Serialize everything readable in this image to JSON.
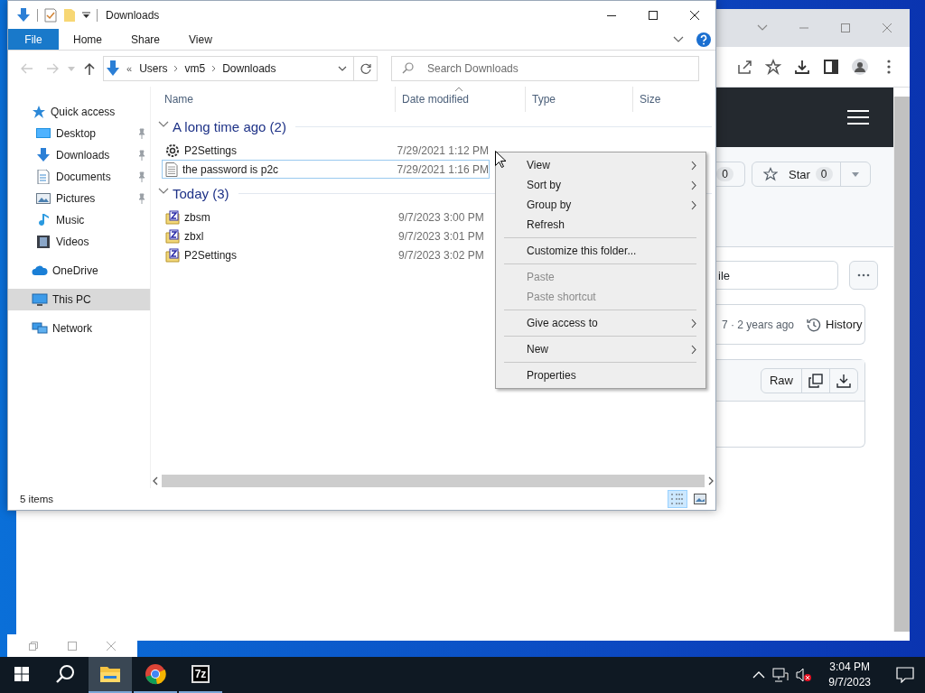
{
  "browser": {
    "fork_count": "0",
    "star_button": {
      "label": "Star",
      "count": "0"
    },
    "file_field": {
      "value": "ile"
    },
    "commit_text": "7 · 2 years ago",
    "history_button": "History",
    "raw_button": "Raw"
  },
  "explorer": {
    "title": "Downloads",
    "ribbon_tabs": [
      {
        "label": "File",
        "kind": "file"
      },
      {
        "label": "Home",
        "kind": "tab"
      },
      {
        "label": "Share",
        "kind": "tab"
      },
      {
        "label": "View",
        "kind": "tab"
      }
    ],
    "breadcrumb_overflow": "«",
    "breadcrumb": [
      "Users",
      "vm5",
      "Downloads"
    ],
    "search": {
      "placeholder": "Search Downloads"
    },
    "nav": [
      {
        "label": "Quick access",
        "selected": false,
        "children": [
          {
            "label": "Desktop",
            "pinned": true,
            "selected": false
          },
          {
            "label": "Downloads",
            "pinned": true,
            "selected": false
          },
          {
            "label": "Documents",
            "pinned": true,
            "selected": false
          },
          {
            "label": "Pictures",
            "pinned": true,
            "selected": false
          },
          {
            "label": "Music",
            "pinned": false,
            "selected": false
          },
          {
            "label": "Videos",
            "pinned": false,
            "selected": false
          }
        ]
      },
      {
        "label": "OneDrive",
        "selected": false
      },
      {
        "label": "This PC",
        "selected": true
      },
      {
        "label": "Network",
        "selected": false
      }
    ],
    "columns": [
      "Name",
      "Date modified",
      "Type",
      "Size"
    ],
    "groups": [
      {
        "title": "A long time ago (2)",
        "expanded": true,
        "files": [
          {
            "name": "P2Settings",
            "kind": "application",
            "date": "7/29/2021 1:12 PM",
            "focused": false
          },
          {
            "name": "the password is p2c",
            "kind": "document",
            "date": "7/29/2021 1:16 PM",
            "focused": true
          }
        ]
      },
      {
        "title": "Today (3)",
        "expanded": true,
        "files": [
          {
            "name": "zbsm",
            "kind": "archive",
            "date": "9/7/2023 3:00 PM",
            "focused": false
          },
          {
            "name": "zbxl",
            "kind": "archive",
            "date": "9/7/2023 3:01 PM",
            "focused": false
          },
          {
            "name": "P2Settings",
            "kind": "archive",
            "date": "9/7/2023 3:02 PM",
            "focused": false
          }
        ]
      }
    ],
    "status": "5 items",
    "view_buttons": [
      {
        "kind": "details",
        "selected": true
      },
      {
        "kind": "large",
        "selected": false
      }
    ]
  },
  "context_menu": [
    {
      "kind": "item",
      "label": "View",
      "submenu": true,
      "disabled": false
    },
    {
      "kind": "item",
      "label": "Sort by",
      "submenu": true,
      "disabled": false
    },
    {
      "kind": "item",
      "label": "Group by",
      "submenu": true,
      "disabled": false
    },
    {
      "kind": "item",
      "label": "Refresh",
      "submenu": false,
      "disabled": false
    },
    {
      "kind": "separator"
    },
    {
      "kind": "item",
      "label": "Customize this folder...",
      "submenu": false,
      "disabled": false
    },
    {
      "kind": "separator"
    },
    {
      "kind": "item",
      "label": "Paste",
      "submenu": false,
      "disabled": true
    },
    {
      "kind": "item",
      "label": "Paste shortcut",
      "submenu": false,
      "disabled": true
    },
    {
      "kind": "separator"
    },
    {
      "kind": "item",
      "label": "Give access to",
      "submenu": true,
      "disabled": false
    },
    {
      "kind": "separator"
    },
    {
      "kind": "item",
      "label": "New",
      "submenu": true,
      "disabled": false
    },
    {
      "kind": "separator"
    },
    {
      "kind": "item",
      "label": "Properties",
      "submenu": false,
      "disabled": false
    }
  ],
  "taskbar": {
    "apps": [
      {
        "kind": "explorer",
        "selected": true,
        "running": true
      },
      {
        "kind": "chrome",
        "selected": false,
        "running": true
      },
      {
        "kind": "sevenzip",
        "label": "7z",
        "selected": false,
        "running": true
      }
    ],
    "clock": {
      "time": "3:04 PM",
      "date": "9/7/2023"
    }
  }
}
